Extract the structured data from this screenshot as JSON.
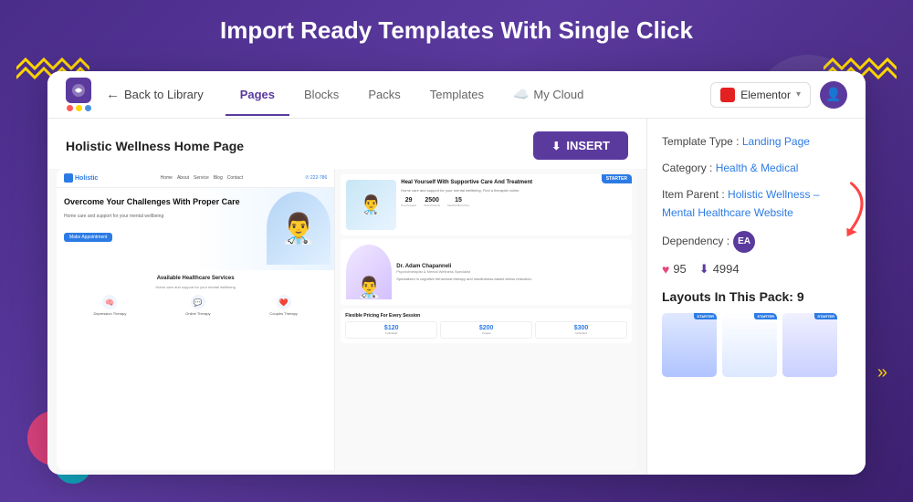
{
  "heading": {
    "title": "Import Ready Templates With Single Click"
  },
  "nav": {
    "back_label": "Back to Library",
    "tabs": [
      {
        "id": "pages",
        "label": "Pages",
        "active": true
      },
      {
        "id": "blocks",
        "label": "Blocks"
      },
      {
        "id": "packs",
        "label": "Packs"
      },
      {
        "id": "templates",
        "label": "Templates"
      },
      {
        "id": "mycloud",
        "label": "My Cloud"
      }
    ],
    "elementor_label": "Elementor",
    "insert_label": "INSERT"
  },
  "template": {
    "title": "Holistic Wellness Home Page",
    "type_label": "Template Type :",
    "type_value": "Landing Page",
    "category_label": "Category :",
    "category_value": "Health & Medical",
    "item_parent_label": "Item Parent :",
    "item_parent_value": "Holistic Wellness – Mental Healthcare Website",
    "dependency_label": "Dependency :",
    "dependency_value": "EA",
    "likes": "95",
    "downloads": "4994",
    "layouts_title": "Layouts In This Pack: 9"
  },
  "preview": {
    "hero_title": "Overcome Your Challenges With Proper Care",
    "hero_subtitle": "Home care and support for your mental wellbeing",
    "hero_btn": "Make Appointment",
    "services_title": "Available Healthcare Services",
    "services_sub": "Home care and support for your mental wellbeing",
    "services": [
      {
        "icon": "🧠",
        "label": "Depression Therapy"
      },
      {
        "icon": "💬",
        "label": "Online Therapy"
      },
      {
        "icon": "❤️",
        "label": "Couples Therapy"
      }
    ],
    "right_panel_title": "Heal Yourself With Supportive Care And Treatment",
    "right_panel_desc": "Home care and support for your mental wellbeing. Find a therapist online.",
    "stats": [
      {
        "num": "29",
        "label": "Psychologist"
      },
      {
        "num": "2500",
        "label": "Total Patients"
      },
      {
        "num": "15",
        "label": "Medical Branches"
      }
    ],
    "doctor_name": "Dr. Adam Chapanneli",
    "doctor_subtitle": "Psychotherapist & Mental Wellness Specialist",
    "pricing_title": "Flexible Pricing For Every Session",
    "prices": [
      {
        "amount": "$120",
        "plan": "Individual"
      },
      {
        "amount": "$200",
        "plan": "Couple"
      },
      {
        "amount": "$300",
        "plan": "Unlimited"
      }
    ]
  }
}
